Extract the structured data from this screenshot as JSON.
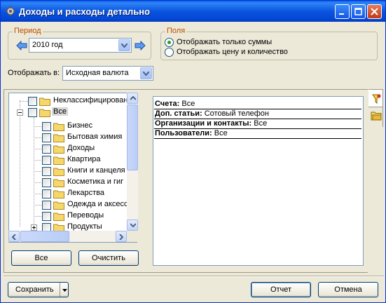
{
  "window": {
    "title": "Доходы и расходы детально"
  },
  "period": {
    "group_label": "Период",
    "value": "2010 год"
  },
  "fields": {
    "group_label": "Поля",
    "options": [
      {
        "label": "Отображать только суммы",
        "selected": true
      },
      {
        "label": "Отображать цену и количество",
        "selected": false
      }
    ]
  },
  "display_in": {
    "label": "Отображать в:",
    "value": "Исходная валюта"
  },
  "tree": {
    "items": [
      {
        "label": "Неклассифицирован"
      },
      {
        "label": "Все"
      },
      {
        "label": "Бизнес"
      },
      {
        "label": "Бытовая химия"
      },
      {
        "label": "Доходы"
      },
      {
        "label": "Квартира"
      },
      {
        "label": "Книги и канцеля"
      },
      {
        "label": "Косметика и гиг"
      },
      {
        "label": "Лекарства"
      },
      {
        "label": "Одежда и аксесс"
      },
      {
        "label": "Переводы"
      },
      {
        "label": "Продукты"
      }
    ]
  },
  "tree_buttons": {
    "all": "Все",
    "clear": "Очистить"
  },
  "filter": {
    "rows": [
      {
        "key": "Счета:",
        "value": "Все"
      },
      {
        "key": "Доп. статьи:",
        "value": "Сотовый телефон"
      },
      {
        "key": "Организации и контакты:",
        "value": "Все"
      },
      {
        "key": "Пользователи:",
        "value": "Все"
      }
    ]
  },
  "footer": {
    "save": "Сохранить",
    "report": "Отчет",
    "cancel": "Отмена"
  },
  "colors": {
    "titlebar": "#0a54e0",
    "group_label": "#c04a00",
    "radio_dot": "#21a121",
    "arrow": "#2b6fd6"
  }
}
